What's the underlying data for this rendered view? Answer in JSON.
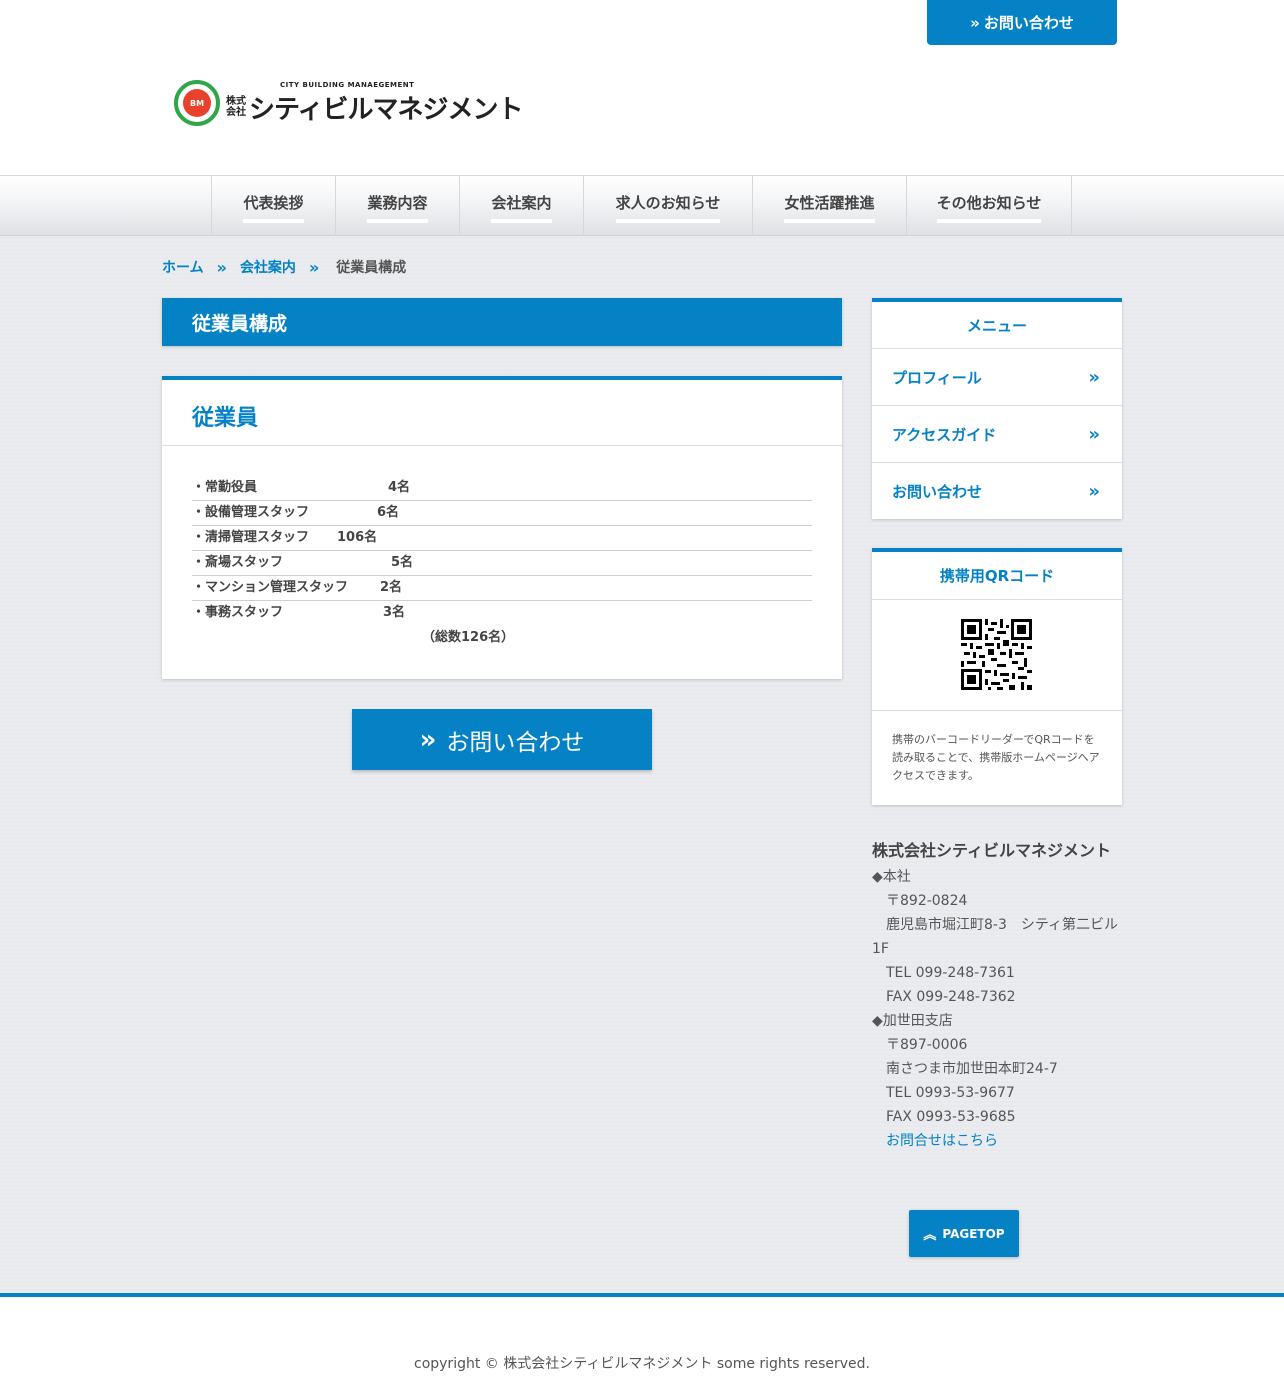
{
  "header": {
    "contact_button": "お問い合わせ",
    "logo": {
      "sub": "CITY BUILDING MANAEGEMENT",
      "kaisha": "株式会社",
      "name": "シティビルマネジメント",
      "mark": "BM"
    }
  },
  "nav": {
    "items": [
      {
        "label": "代表挨拶"
      },
      {
        "label": "業務内容"
      },
      {
        "label": "会社案内"
      },
      {
        "label": "求人のお知らせ"
      },
      {
        "label": "女性活躍推進"
      },
      {
        "label": "その他お知らせ"
      }
    ]
  },
  "breadcrumb": {
    "home": "ホーム",
    "parent": "会社案内",
    "current": "従業員構成"
  },
  "page_title": "従業員構成",
  "content": {
    "heading": "従業員",
    "staff": [
      {
        "label": "・常勤役員",
        "value": "4名"
      },
      {
        "label": "・設備管理スタッフ",
        "value": "6名"
      },
      {
        "label": "・清掃管理スタッフ",
        "value": "106名"
      },
      {
        "label": "・斎場スタッフ",
        "value": "5名"
      },
      {
        "label": "・マンション管理スタッフ",
        "value": "2名"
      },
      {
        "label": "・事務スタッフ",
        "value": "3名"
      }
    ],
    "total": "（総数126名）",
    "contact_button": "お問い合わせ"
  },
  "sidebar": {
    "menu_title": "メニュー",
    "menu_items": [
      {
        "label": "プロフィール"
      },
      {
        "label": "アクセスガイド"
      },
      {
        "label": "お問い合わせ"
      }
    ],
    "qr_title": "携帯用QRコード",
    "qr_desc": "携帯のバーコードリーダーでQRコードを読み取ることで、携帯版ホームページへアクセスできます。"
  },
  "company": {
    "name": "株式会社シティビルマネジメント",
    "head_office": "◆本社",
    "head_zip": "〒892-0824",
    "head_addr": "鹿児島市堀江町8-3　シティ第二ビル1F",
    "head_tel": "TEL 099-248-7361",
    "head_fax": "FAX 099-248-7362",
    "branch": "◆加世田支店",
    "branch_zip": "〒897-0006",
    "branch_addr": "南さつま市加世田本町24-7",
    "branch_tel": "TEL 0993-53-9677",
    "branch_fax": "FAX 0993-53-9685",
    "contact_link": "お問合せはこちら"
  },
  "pagetop": "PAGETOP",
  "footer": {
    "copyright": "copyright © 株式会社シティビルマネジメント some rights reserved."
  },
  "colors": {
    "accent": "#0582c5",
    "logo_green": "#2fa64a",
    "logo_red": "#e8412c"
  }
}
